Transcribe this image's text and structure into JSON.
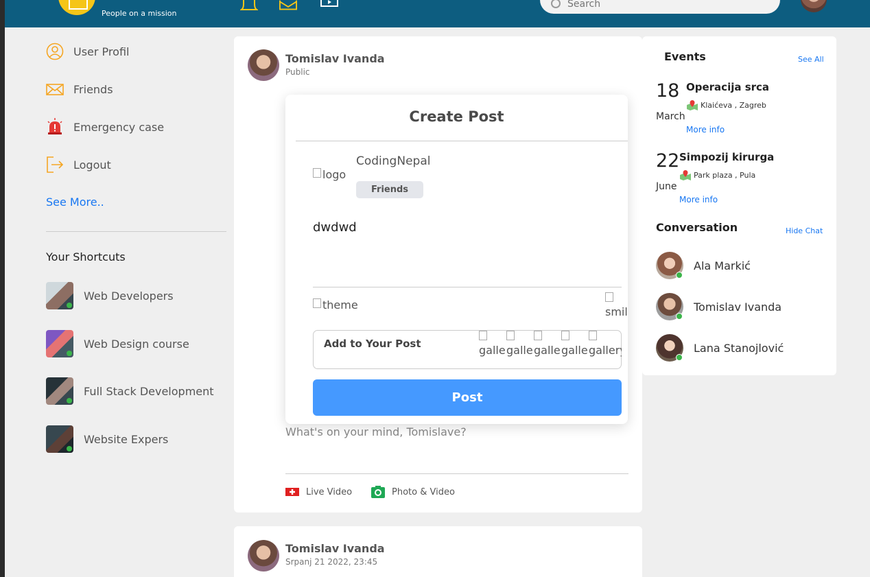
{
  "header": {
    "tagline": "People on a mission",
    "search_placeholder": "Search"
  },
  "sidebar": {
    "items": [
      {
        "label": "User Profil",
        "icon": "user-icon"
      },
      {
        "label": "Friends",
        "icon": "mail-icon"
      },
      {
        "label": "Emergency case",
        "icon": "alarm-icon"
      },
      {
        "label": "Logout",
        "icon": "logout-icon"
      }
    ],
    "see_more": "See More..",
    "shortcuts_title": "Your Shortcuts",
    "shortcuts": [
      {
        "label": "Web Developers"
      },
      {
        "label": "Web Design course"
      },
      {
        "label": "Full Stack Development"
      },
      {
        "label": "Website Expers"
      }
    ]
  },
  "post_card": {
    "author": "Tomislav Ivanda",
    "visibility": "Public",
    "placeholder": "What's on your mind, Tomislave?",
    "actions": [
      {
        "label": "Live Video",
        "icon": "live-video-icon"
      },
      {
        "label": "Photo & Video",
        "icon": "camera-icon"
      }
    ]
  },
  "modal": {
    "title": "Create Post",
    "logo_alt": "logo",
    "name": "CodingNepal",
    "privacy": "Friends",
    "text": "dwdwd",
    "theme_alt": "theme",
    "smile_alt": "smile",
    "add_label": "Add to Your Post",
    "gallery_alt": "gallery",
    "post_button": "Post"
  },
  "second_post": {
    "author": "Tomislav Ivanda",
    "timestamp": "Srpanj 21 2022, 23:45"
  },
  "events": {
    "title": "Events",
    "see_all": "See All",
    "list": [
      {
        "day": "18",
        "month": "March",
        "name": "Operacija srca",
        "location": "Klaićeva , Zagreb",
        "more": "More info"
      },
      {
        "day": "22",
        "month": "June",
        "name": "Simpozij kirurga",
        "location": "Park plaza , Pula",
        "more": "More info"
      }
    ]
  },
  "conversation": {
    "title": "Conversation",
    "hide": "Hide Chat",
    "contacts": [
      {
        "name": "Ala Markić"
      },
      {
        "name": "Tomislav Ivanda"
      },
      {
        "name": "Lana Stanojlović"
      }
    ]
  },
  "colors": {
    "topbar": "#0d5d80",
    "accent": "#f5c518",
    "link": "#1877f2",
    "post_button": "#4599ff"
  }
}
